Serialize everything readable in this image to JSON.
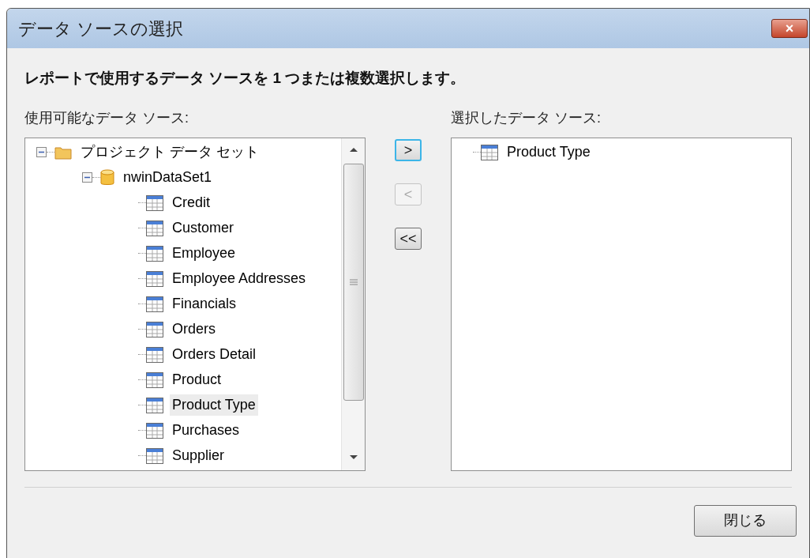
{
  "window": {
    "title": "データ ソースの選択",
    "close": "×"
  },
  "instruction": "レポートで使用するデータ ソースを 1 つまたは複数選択します。",
  "available": {
    "label": "使用可能なデータ ソース:",
    "tree": [
      {
        "label": "プロジェクト データ セット",
        "kind": "folder",
        "expanded": true,
        "selected": false,
        "children": [
          {
            "label": "nwinDataSet1",
            "kind": "database",
            "expanded": true,
            "selected": false,
            "children": [
              {
                "label": "Credit",
                "kind": "table",
                "selected": false
              },
              {
                "label": "Customer",
                "kind": "table",
                "selected": false
              },
              {
                "label": "Employee",
                "kind": "table",
                "selected": false
              },
              {
                "label": "Employee Addresses",
                "kind": "table",
                "selected": false
              },
              {
                "label": "Financials",
                "kind": "table",
                "selected": false
              },
              {
                "label": "Orders",
                "kind": "table",
                "selected": false
              },
              {
                "label": "Orders Detail",
                "kind": "table",
                "selected": false
              },
              {
                "label": "Product",
                "kind": "table",
                "selected": false
              },
              {
                "label": "Product Type",
                "kind": "table",
                "selected": true
              },
              {
                "label": "Purchases",
                "kind": "table",
                "selected": false
              },
              {
                "label": "Supplier",
                "kind": "table",
                "selected": false
              }
            ]
          }
        ]
      }
    ]
  },
  "move_buttons": [
    {
      "label": ">",
      "disabled": false
    },
    {
      "label": "<",
      "disabled": true
    },
    {
      "label": "<<",
      "disabled": false
    }
  ],
  "selected_sources": {
    "label": "選択したデータ ソース:",
    "items": [
      {
        "label": "Product Type",
        "kind": "table",
        "selected": false
      }
    ]
  },
  "buttons": [
    "閉じる"
  ]
}
